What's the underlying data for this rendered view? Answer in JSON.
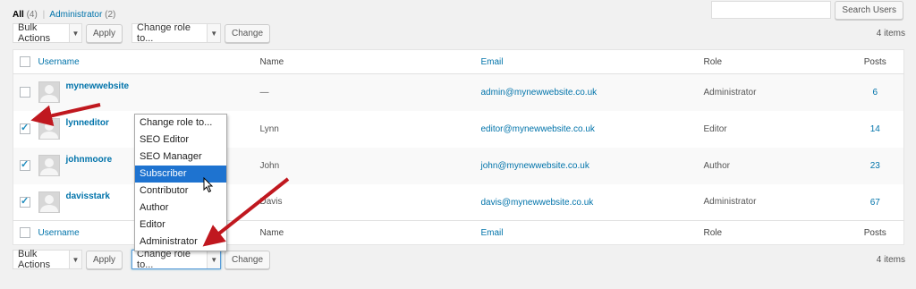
{
  "views": {
    "all_label": "All",
    "all_count": "(4)",
    "separator": "|",
    "admin_label": "Administrator",
    "admin_count": "(2)"
  },
  "search": {
    "placeholder": "",
    "button_label": "Search Users"
  },
  "top_nav": {
    "bulk_actions": "Bulk Actions",
    "apply": "Apply",
    "change_role": "Change role to...",
    "change": "Change",
    "items_count": "4 items"
  },
  "bottom_nav": {
    "bulk_actions": "Bulk Actions",
    "apply": "Apply",
    "change_role": "Change role to...",
    "change": "Change",
    "items_count": "4 items"
  },
  "columns": {
    "username": "Username",
    "name": "Name",
    "email": "Email",
    "role": "Role",
    "posts": "Posts"
  },
  "rows": [
    {
      "username": "mynewwebsite",
      "name": "—",
      "email": "admin@mynewwebsite.co.uk",
      "role": "Administrator",
      "posts": "6",
      "checked": false
    },
    {
      "username": "lynneditor",
      "name": "Lynn",
      "email": "editor@mynewwebsite.co.uk",
      "role": "Editor",
      "posts": "14",
      "checked": true
    },
    {
      "username": "johnmoore",
      "name": "John",
      "email": "john@mynewwebsite.co.uk",
      "role": "Author",
      "posts": "23",
      "checked": true
    },
    {
      "username": "davisstark",
      "name": "Davis",
      "email": "davis@mynewwebsite.co.uk",
      "role": "Administrator",
      "posts": "67",
      "checked": true
    }
  ],
  "role_dropdown": {
    "options": [
      "Change role to...",
      "SEO Editor",
      "SEO Manager",
      "Subscriber",
      "Contributor",
      "Author",
      "Editor",
      "Administrator"
    ],
    "highlighted": "Subscriber"
  },
  "colors": {
    "link": "#0073aa",
    "highlight": "#1e73d0",
    "annotation_arrow": "#c0181f"
  },
  "icons": [
    "chevron-down-icon",
    "checkmark-icon",
    "avatar-icon",
    "mouse-cursor-icon",
    "annotation-arrow-icon"
  ]
}
